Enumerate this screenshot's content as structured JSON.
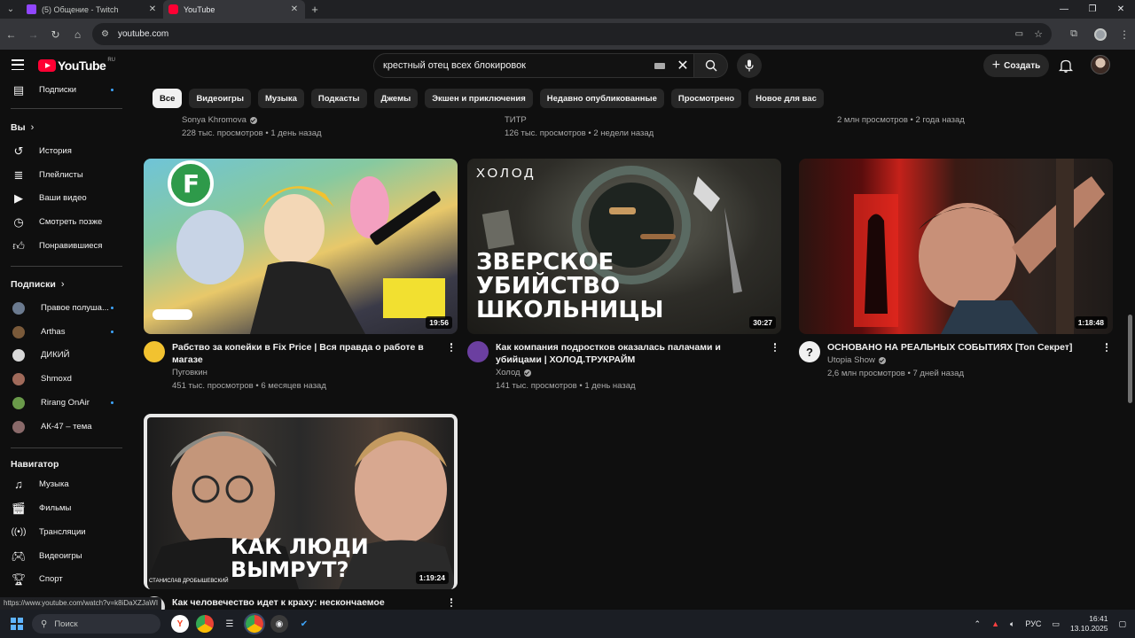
{
  "browser": {
    "tabs": [
      {
        "label": "(5) Общение - Twitch",
        "active": false
      },
      {
        "label": "YouTube",
        "active": true
      }
    ],
    "url": "youtube.com"
  },
  "header": {
    "logo_text": "YouTube",
    "region": "RU",
    "search_query": "крестный отец всех блокировок",
    "create_label": "Создать"
  },
  "sidebar": {
    "subscriptions_link": "Подписки",
    "you_heading": "Вы",
    "you_items": [
      "История",
      "Плейлисты",
      "Ваши видео",
      "Смотреть позже",
      "Понравившиеся"
    ],
    "subs_heading": "Подписки",
    "channels": [
      {
        "name": "Правое полуша...",
        "color": "#6b7a8f",
        "new": true
      },
      {
        "name": "Arthas",
        "color": "#7a5a3a",
        "new": true
      },
      {
        "name": "ДИКИЙ",
        "color": "#d8d8d8",
        "new": false
      },
      {
        "name": "Shmoxd",
        "color": "#a06a5a",
        "new": false
      },
      {
        "name": "Rirang OnAir",
        "color": "#6a9a4a",
        "new": true
      },
      {
        "name": "АК-47 – тема",
        "color": "#8a6a6a",
        "new": false
      }
    ],
    "nav_heading": "Навигатор",
    "nav_items": [
      "Музыка",
      "Фильмы",
      "Трансляции",
      "Видеоигры",
      "Спорт"
    ]
  },
  "chips": [
    "Все",
    "Видеоигры",
    "Музыка",
    "Подкасты",
    "Джемы",
    "Экшен и приключения",
    "Недавно опубликованные",
    "Просмотрено",
    "Новое для вас"
  ],
  "prev_row": [
    {
      "channel": "Sonya Khromova",
      "verified": true,
      "stats": "228 тыс. просмотров • 1 день назад"
    },
    {
      "channel": "ТИТР",
      "verified": false,
      "stats": "126 тыс. просмотров • 2 недели назад"
    },
    {
      "channel": "",
      "verified": false,
      "stats": "2 млн просмотров • 2 года назад"
    }
  ],
  "videos": [
    {
      "title": "Рабство за копейки в Fix Price | Вся правда о работе в магазе",
      "channel": "Пуговкин",
      "verified": false,
      "stats": "451 тыс. просмотров • 6 месяцев назад",
      "duration": "19:56",
      "avatar_color": "#f2c230"
    },
    {
      "title": "Как компания подростков оказалась палачами и убийцами | ХОЛОД.ТРУКРАЙМ",
      "channel": "Холод",
      "verified": true,
      "stats": "141 тыс. просмотров • 1 день назад",
      "duration": "30:27",
      "avatar_color": "#6b3fa0",
      "thumb_brand": "ХОЛОД",
      "thumb_text": [
        "ЗВЕРСКОЕ",
        "УБИЙСТВО",
        "ШКОЛЬНИЦЫ"
      ]
    },
    {
      "title": "ОСНОВАНО НА РЕАЛЬНЫХ СОБЫТИЯХ [Топ Секрет]",
      "channel": "Utopia Show",
      "verified": true,
      "stats": "2,6 млн просмотров • 7 дней назад",
      "duration": "1:18:48",
      "avatar_color": "#f1f1f1"
    },
    {
      "title": "Как человечество идет к краху: нескончаемое потребление",
      "duration": "1:19:24",
      "thumb_text": [
        "КАК ЛЮДИ",
        "ВЫМРУТ?"
      ],
      "thumb_caption": "СТАНИСЛАВ ДРОБЫШЕВСКИЙ"
    }
  ],
  "status_url": "https://www.youtube.com/watch?v=k8iDaXZJaWI",
  "taskbar": {
    "search_placeholder": "Поиск",
    "lang": "РУС",
    "time": "16:41",
    "date": "13.10.2025"
  }
}
